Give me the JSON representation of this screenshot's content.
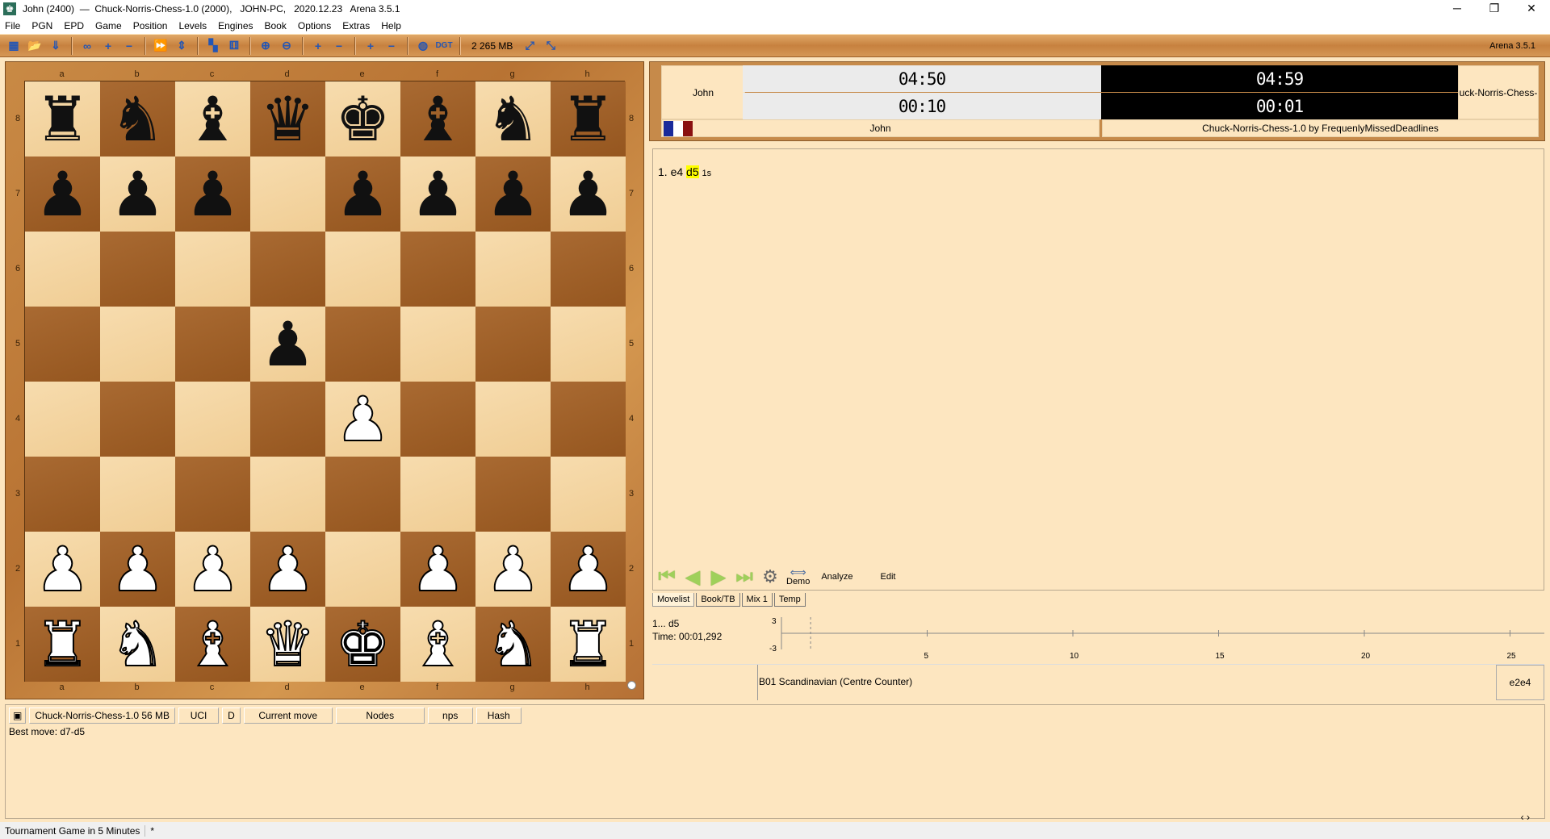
{
  "title": "John (2400)  —  Chuck-Norris-Chess-1.0 (2000),   JOHN-PC,   2020.12.23   Arena 3.5.1",
  "window_controls": {
    "minimize": "─",
    "restore": "❐",
    "close": "✕"
  },
  "menu": [
    "File",
    "PGN",
    "EPD",
    "Game",
    "Position",
    "Levels",
    "Engines",
    "Book",
    "Options",
    "Extras",
    "Help"
  ],
  "toolbar": {
    "memory": "2 265 MB",
    "version": "Arena 3.5.1",
    "icons": [
      "new-game",
      "open",
      "save",
      "infinite",
      "level-plus",
      "level-minus",
      "fast-forward",
      "flip",
      "board-setup",
      "engine-manager",
      "zoom-in",
      "zoom-out",
      "pgn-plus",
      "pgn-minus",
      "epd-plus",
      "epd-minus",
      "globe",
      "dgt",
      "maximize",
      "minimize"
    ]
  },
  "board": {
    "files": [
      "a",
      "b",
      "c",
      "d",
      "e",
      "f",
      "g",
      "h"
    ],
    "ranks": [
      "8",
      "7",
      "6",
      "5",
      "4",
      "3",
      "2",
      "1"
    ],
    "position": [
      "rnbqkbnr",
      "ppp.pppp",
      "........",
      "...p....",
      "....P...",
      "........",
      "PPPP.PPP",
      "RNBQKBNR"
    ],
    "colors": {
      "light": "#f3d39f",
      "dark": "#9e5f28"
    }
  },
  "clock": {
    "white_name": "John",
    "black_name": "Chuck-Norris-Chess-1.0",
    "black_name_visible": "uck-Norris-Chess-",
    "white_time": "04:50",
    "white_move_time": "00:10",
    "black_time": "04:59",
    "black_move_time": "00:01",
    "white_label": "John",
    "black_label": "Chuck-Norris-Chess-1.0 by FrequenlyMissedDeadlines"
  },
  "movelist": {
    "moveno": "1.",
    "white": "e4",
    "black": "d5",
    "time": "1s"
  },
  "nav": {
    "analyze": "Analyze",
    "edit": "Edit",
    "demo": "Demo"
  },
  "tabs": [
    "Movelist",
    "Book/TB",
    "Mix 1",
    "Temp"
  ],
  "graph": {
    "move": "1... d5",
    "time": "Time: 00:01,292",
    "ymax": "3",
    "ymin": "-3",
    "xticks": [
      "5",
      "10",
      "15",
      "20",
      "25"
    ]
  },
  "opening": {
    "eco": "B01  Scandinavian (Centre Counter)",
    "move": "e2e4"
  },
  "engine": {
    "headers": [
      "Chuck-Norris-Chess-1.0  56 MB",
      "UCI",
      "D",
      "Current move",
      "Nodes",
      "nps",
      "Hash"
    ],
    "output": "Best move: d7-d5"
  },
  "status": {
    "text": "Tournament Game in 5 Minutes",
    "flag": "*"
  }
}
